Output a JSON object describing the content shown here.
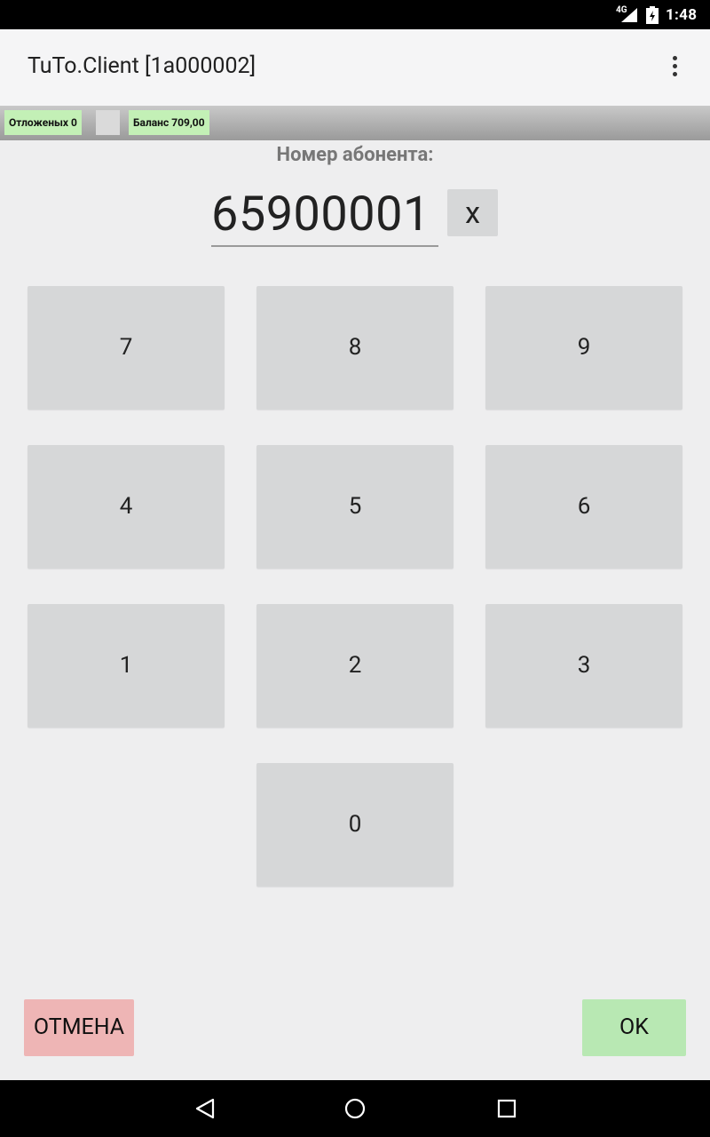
{
  "status_bar": {
    "network": "4G",
    "time": "1:48"
  },
  "app_bar": {
    "title": "TuTo.Client [1a000002]"
  },
  "info_strip": {
    "deferred": "Отложеных 0",
    "balance": "Баланс 709,00"
  },
  "input": {
    "label": "Номер абонента:",
    "value": "65900001",
    "clear_label": "x"
  },
  "keypad": {
    "k7": "7",
    "k8": "8",
    "k9": "9",
    "k4": "4",
    "k5": "5",
    "k6": "6",
    "k1": "1",
    "k2": "2",
    "k3": "3",
    "k0": "0"
  },
  "actions": {
    "cancel": "ОТМЕНА",
    "ok": "OK"
  },
  "icons": {
    "overflow": "overflow-menu-icon",
    "back": "back-icon",
    "home": "home-icon",
    "recents": "recents-icon"
  }
}
